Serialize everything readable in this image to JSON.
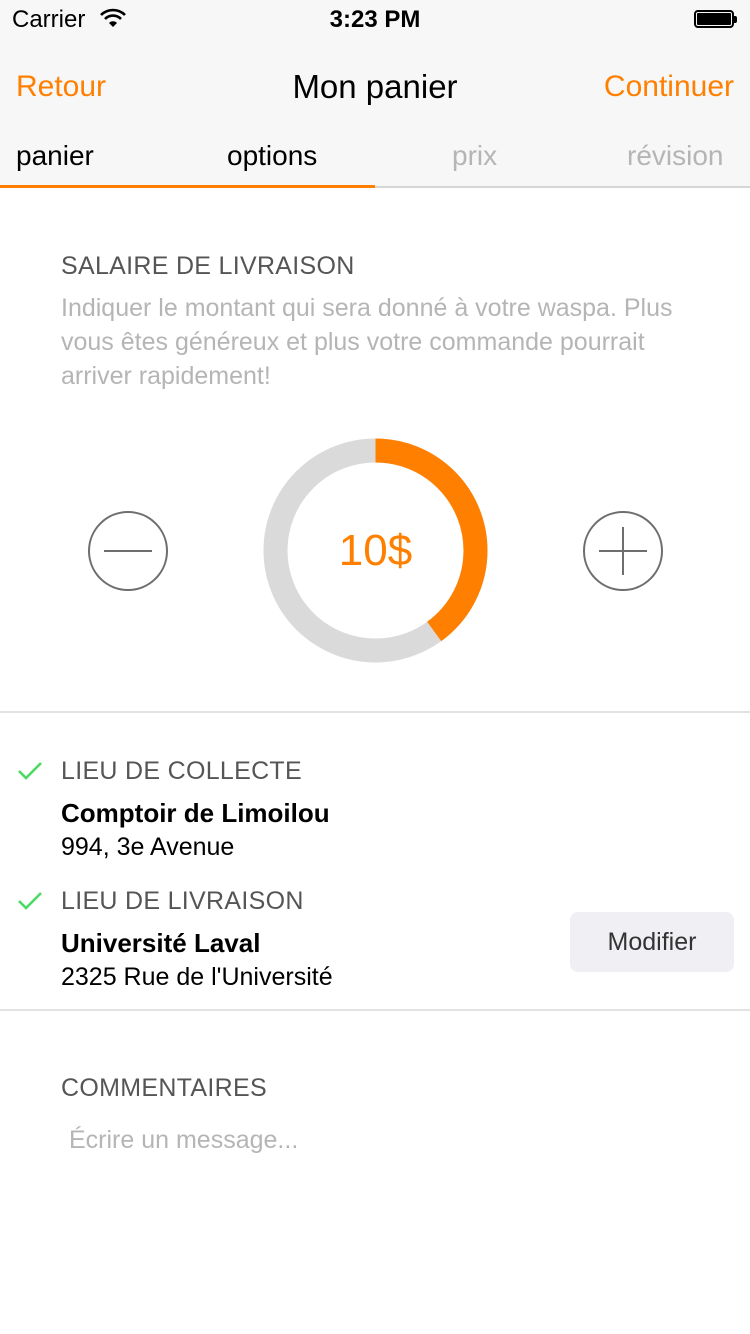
{
  "status_bar": {
    "carrier": "Carrier",
    "time": "3:23 PM"
  },
  "nav": {
    "back_label": "Retour",
    "title": "Mon panier",
    "continue_label": "Continuer"
  },
  "tabs": [
    {
      "label": "panier"
    },
    {
      "label": "options"
    },
    {
      "label": "prix"
    },
    {
      "label": "révision"
    }
  ],
  "step_progress": 0.5,
  "delivery_fee": {
    "title": "SALAIRE DE LIVRAISON",
    "description": "Indiquer le montant qui sera donné à votre waspa. Plus vous êtes généreux et plus votre commande pourrait arriver rapidement!",
    "value_label": "10$",
    "gauge_fraction": 0.4
  },
  "pickup": {
    "label": "LIEU DE COLLECTE",
    "name": "Comptoir de Limoilou",
    "address": "994, 3e Avenue"
  },
  "dropoff": {
    "label": "LIEU DE LIVRAISON",
    "name": "Université Laval",
    "address": "2325 Rue de l'Université"
  },
  "modify_label": "Modifier",
  "comments": {
    "title": "COMMENTAIRES",
    "placeholder": "Écrire un message..."
  },
  "colors": {
    "accent": "#ff8000",
    "check": "#4cd964",
    "track": "#dadada"
  }
}
